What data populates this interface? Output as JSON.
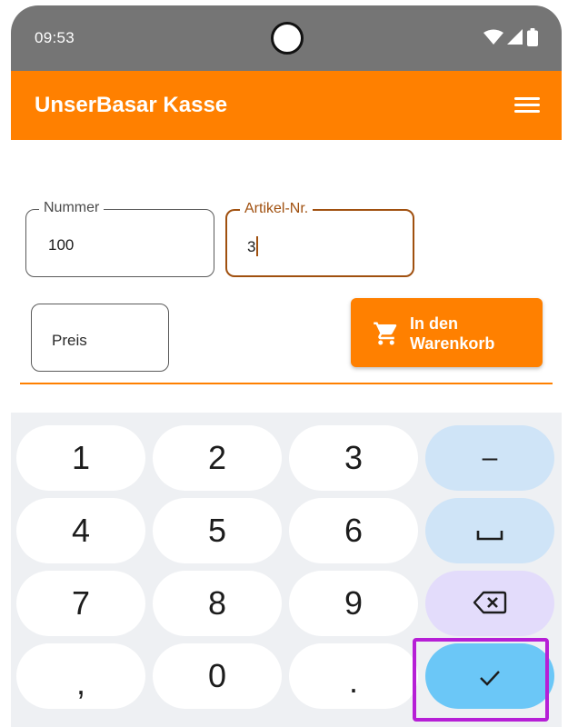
{
  "status_bar": {
    "time": "09:53"
  },
  "app_bar": {
    "title": "UnserBasar Kasse"
  },
  "form": {
    "nummer": {
      "label": "Nummer",
      "value": "100"
    },
    "artikel": {
      "label": "Artikel-Nr.",
      "value": "3"
    },
    "preis": {
      "placeholder": "Preis"
    },
    "cart_button": {
      "label": "In den\nWarenkorb"
    }
  },
  "keyboard": {
    "keys": [
      "1",
      "2",
      "3",
      "4",
      "5",
      "6",
      "7",
      "8",
      "9",
      ",",
      "0",
      "."
    ],
    "minus": "–"
  },
  "colors": {
    "accent": "#ff8000",
    "focus": "#a0500f",
    "status_bar": "#757575",
    "key_action": "#cfe4f7",
    "key_backspace": "#e3dcfb",
    "key_enter": "#6bc7f7",
    "highlight": "#b61fd6"
  },
  "icons": [
    "wifi-icon",
    "signal-icon",
    "battery-icon",
    "menu-icon",
    "cart-icon",
    "space-icon",
    "backspace-icon",
    "check-icon"
  ]
}
